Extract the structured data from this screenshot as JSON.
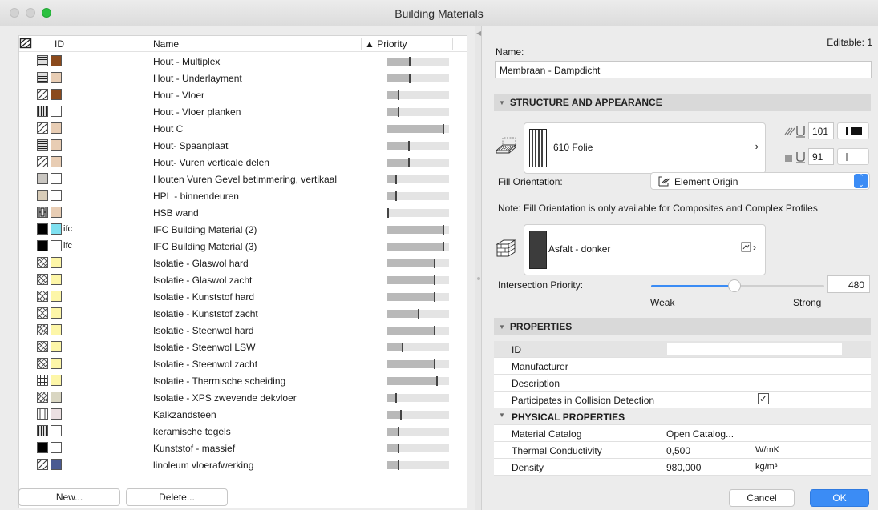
{
  "window": {
    "title": "Building Materials"
  },
  "table": {
    "headers": {
      "id": "ID",
      "name": "Name",
      "priority": "▲ Priority"
    },
    "rows": [
      {
        "name": "Hout - Multiplex",
        "fill": "lines-h",
        "color": "#8b4a1c",
        "ifc": "",
        "priority": 0.38
      },
      {
        "name": "Hout - Underlayment",
        "fill": "lines-h",
        "color": "#e8cdb4",
        "ifc": "",
        "priority": 0.38
      },
      {
        "name": "Hout - Vloer",
        "fill": "diag",
        "color": "#8b4a1c",
        "ifc": "",
        "priority": 0.2
      },
      {
        "name": "Hout - Vloer planken",
        "fill": "lines-v",
        "color": "#ffffff",
        "ifc": "",
        "priority": 0.2
      },
      {
        "name": "Hout C",
        "fill": "diag",
        "color": "#e8cdb4",
        "ifc": "",
        "priority": 0.92
      },
      {
        "name": "Hout- Spaanplaat",
        "fill": "lines-h",
        "color": "#e8cdb4",
        "ifc": "",
        "priority": 0.36
      },
      {
        "name": "Hout- Vuren verticale delen",
        "fill": "diag",
        "color": "#e8cdb4",
        "ifc": "",
        "priority": 0.36
      },
      {
        "name": "Houten Vuren Gevel betimmering, vertikaal",
        "fill": "solid-grey",
        "color": "#ffffff",
        "ifc": "",
        "priority": 0.16
      },
      {
        "name": "HPL - binnendeuren",
        "fill": "solid-tan",
        "color": "#ffffff",
        "ifc": "",
        "priority": 0.16
      },
      {
        "name": "HSB wand",
        "fill": "hsb",
        "color": "#e8cdb4",
        "ifc": "",
        "priority": 0.02
      },
      {
        "name": "IFC Building Material (2)",
        "fill": "black",
        "color": "#7fe0f0",
        "ifc": "ifc",
        "priority": 0.92
      },
      {
        "name": "IFC Building Material (3)",
        "fill": "black",
        "color": "#ffffff",
        "ifc": "ifc",
        "priority": 0.92
      },
      {
        "name": "Isolatie - Glaswol hard",
        "fill": "cross",
        "color": "#fdf6a8",
        "ifc": "",
        "priority": 0.78
      },
      {
        "name": "Isolatie - Glaswol zacht",
        "fill": "cross",
        "color": "#fdf6a8",
        "ifc": "",
        "priority": 0.78
      },
      {
        "name": "Isolatie - Kunststof hard",
        "fill": "x",
        "color": "#fdf6a8",
        "ifc": "",
        "priority": 0.78
      },
      {
        "name": "Isolatie - Kunststof zacht",
        "fill": "x",
        "color": "#fdf6a8",
        "ifc": "",
        "priority": 0.52
      },
      {
        "name": "Isolatie - Steenwol hard",
        "fill": "cross",
        "color": "#fdf6a8",
        "ifc": "",
        "priority": 0.78
      },
      {
        "name": "Isolatie - Steenwol LSW",
        "fill": "cross",
        "color": "#fdf6a8",
        "ifc": "",
        "priority": 0.26
      },
      {
        "name": "Isolatie - Steenwol zacht",
        "fill": "cross",
        "color": "#fdf6a8",
        "ifc": "",
        "priority": 0.78
      },
      {
        "name": "Isolatie - Thermische scheiding",
        "fill": "grid",
        "color": "#fdf6a8",
        "ifc": "",
        "priority": 0.82
      },
      {
        "name": "Isolatie - XPS zwevende dekvloer",
        "fill": "cross",
        "color": "#d9d6c2",
        "ifc": "",
        "priority": 0.16
      },
      {
        "name": "Kalkzandsteen",
        "fill": "lines-v2",
        "color": "#ece0e2",
        "ifc": "",
        "priority": 0.24
      },
      {
        "name": "keramische tegels",
        "fill": "lines-v",
        "color": "#ffffff",
        "ifc": "",
        "priority": 0.2
      },
      {
        "name": "Kunststof - massief",
        "fill": "black",
        "color": "#ffffff",
        "ifc": "",
        "priority": 0.2
      },
      {
        "name": "linoleum vloerafwerking",
        "fill": "diag",
        "color": "#4a5a92",
        "ifc": "",
        "priority": 0.2
      }
    ]
  },
  "buttons": {
    "new": "New...",
    "delete": "Delete...",
    "cancel": "Cancel",
    "ok": "OK"
  },
  "editor": {
    "editable": "Editable: 1",
    "name_label": "Name:",
    "name_value": "Membraan - Dampdicht",
    "structure_header": "STRUCTURE AND APPEARANCE",
    "fill_name": "610 Folie",
    "pen_fg": "101",
    "pen_bg": "91",
    "fill_orientation_label": "Fill Orientation:",
    "fill_orientation_value": "Element Origin",
    "note": "Note: Fill Orientation is only available for Composites and Complex Profiles",
    "surface_name": "Asfalt - donker",
    "intersection_label": "Intersection Priority:",
    "intersection_value": "480",
    "intersection_level": 0.48,
    "weak": "Weak",
    "strong": "Strong"
  },
  "properties": {
    "header": "PROPERTIES",
    "id_label": "ID",
    "manufacturer_label": "Manufacturer",
    "description_label": "Description",
    "collision_label": "Participates in Collision Detection",
    "collision_checked": true,
    "physical_header": "PHYSICAL PROPERTIES",
    "catalog_label": "Material Catalog",
    "catalog_value": "Open Catalog...",
    "conductivity_label": "Thermal Conductivity",
    "conductivity_value": "0,500",
    "conductivity_unit": "W/mK",
    "density_label": "Density",
    "density_value": "980,000",
    "density_unit": "kg/m³"
  },
  "colors": {
    "accent": "#3b8cf5",
    "section_bg": "#d9d9d9"
  }
}
